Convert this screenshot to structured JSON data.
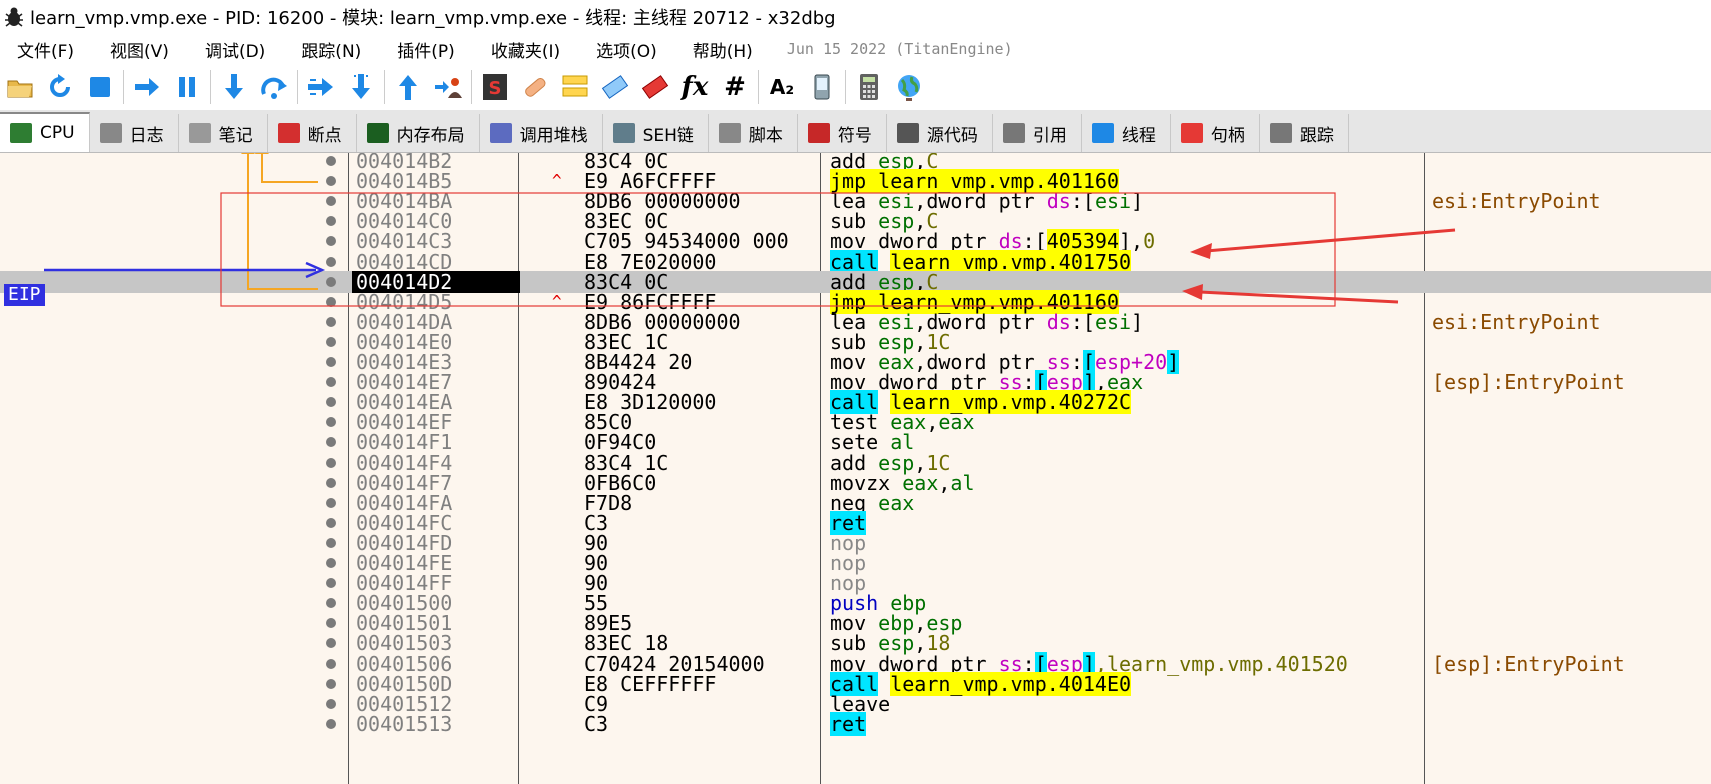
{
  "window": {
    "title": "learn_vmp.vmp.exe - PID: 16200 - 模块: learn_vmp.vmp.exe - 线程: 主线程 20712 - x32dbg"
  },
  "menu": {
    "items": [
      "文件(F)",
      "视图(V)",
      "调试(D)",
      "跟踪(N)",
      "插件(P)",
      "收藏夹(I)",
      "选项(O)",
      "帮助(H)"
    ],
    "build": "Jun 15 2022 (TitanEngine)"
  },
  "toolbar": {
    "icons": [
      "open-icon",
      "restart-icon",
      "stop-icon",
      "run-icon",
      "pause-icon",
      "step-into-icon",
      "step-over-icon",
      "trace-into-icon",
      "trace-over-icon",
      "execute-till-return-icon",
      "run-to-user-code-icon",
      "scylla-icon",
      "patch-icon",
      "comment-icon",
      "label-icon",
      "bookmark-icon",
      "function-icon",
      "hash-icon",
      "font-icon",
      "device-icon",
      "calculator-icon",
      "globe-icon"
    ],
    "fx_label": "fx",
    "hash_label": "#",
    "font_label": "A₂"
  },
  "tabs": [
    {
      "label": "CPU",
      "icon": "cpu-icon",
      "color": "#2e7d32"
    },
    {
      "label": "日志",
      "icon": "log-icon",
      "color": "#888888"
    },
    {
      "label": "笔记",
      "icon": "notes-icon",
      "color": "#999999"
    },
    {
      "label": "断点",
      "icon": "breakpoint-icon",
      "color": "#d32f2f"
    },
    {
      "label": "内存布局",
      "icon": "memory-icon",
      "color": "#1b5e20"
    },
    {
      "label": "调用堆栈",
      "icon": "callstack-icon",
      "color": "#5c6bc0"
    },
    {
      "label": "SEH链",
      "icon": "seh-icon",
      "color": "#607d8b"
    },
    {
      "label": "脚本",
      "icon": "script-icon",
      "color": "#888888"
    },
    {
      "label": "符号",
      "icon": "symbol-icon",
      "color": "#c62828"
    },
    {
      "label": "源代码",
      "icon": "source-icon",
      "color": "#555555"
    },
    {
      "label": "引用",
      "icon": "reference-icon",
      "color": "#777777"
    },
    {
      "label": "线程",
      "icon": "thread-icon",
      "color": "#1e88e5"
    },
    {
      "label": "句柄",
      "icon": "handle-icon",
      "color": "#e53935"
    },
    {
      "label": "跟踪",
      "icon": "trace-icon",
      "color": "#777777"
    }
  ],
  "eip_label": "EIP",
  "rows": [
    {
      "addr": "004014B2",
      "mark": "",
      "bytes": "83C4 0C",
      "dis": [
        [
          "add ",
          ""
        ],
        [
          "esp",
          "reg"
        ],
        [
          ",",
          ""
        ],
        [
          "C",
          "num"
        ]
      ],
      "comment": ""
    },
    {
      "addr": "004014B5",
      "mark": "^",
      "bytes": "E9 A6FCFFFF",
      "dis": [
        [
          "jmp learn_vmp.vmp.401160",
          "hl-y"
        ]
      ],
      "comment": ""
    },
    {
      "addr": "004014BA",
      "mark": "",
      "bytes": "8DB6 00000000",
      "dis": [
        [
          "lea ",
          ""
        ],
        [
          "esi",
          "reg"
        ],
        [
          ",dword ptr ",
          ""
        ],
        [
          "ds",
          "seg"
        ],
        [
          ":[",
          ""
        ],
        [
          "esi",
          "reg"
        ],
        [
          "]",
          ""
        ]
      ],
      "comment": "esi:EntryPoint"
    },
    {
      "addr": "004014C0",
      "mark": "",
      "bytes": "83EC 0C",
      "dis": [
        [
          "sub ",
          ""
        ],
        [
          "esp",
          "reg"
        ],
        [
          ",",
          ""
        ],
        [
          "C",
          "num"
        ]
      ],
      "comment": ""
    },
    {
      "addr": "004014C3",
      "mark": "",
      "bytes": "C705 94534000 000",
      "dis": [
        [
          "mov dword ptr ",
          ""
        ],
        [
          "ds",
          "seg"
        ],
        [
          ":[",
          ""
        ],
        [
          "405394",
          "hl-y"
        ],
        [
          "],",
          ""
        ],
        [
          "0",
          "num"
        ]
      ],
      "comment": ""
    },
    {
      "addr": "004014CD",
      "mark": "",
      "bytes": "E8 7E020000",
      "dis": [
        [
          "call",
          "hl-c"
        ],
        [
          " ",
          ""
        ],
        [
          "learn_vmp.vmp.401750",
          "hl-y"
        ]
      ],
      "comment": ""
    },
    {
      "addr": "004014D2",
      "mark": "",
      "bytes": "83C4 0C",
      "dis": [
        [
          "add ",
          ""
        ],
        [
          "esp",
          "reg"
        ],
        [
          ",",
          ""
        ],
        [
          "C",
          "num"
        ]
      ],
      "comment": "",
      "current": true
    },
    {
      "addr": "004014D5",
      "mark": "^",
      "bytes": "E9 86FCFFFF",
      "dis": [
        [
          "jmp learn_vmp.vmp.401160",
          "hl-y"
        ]
      ],
      "comment": ""
    },
    {
      "addr": "004014DA",
      "mark": "",
      "bytes": "8DB6 00000000",
      "dis": [
        [
          "lea ",
          ""
        ],
        [
          "esi",
          "reg"
        ],
        [
          ",dword ptr ",
          ""
        ],
        [
          "ds",
          "seg"
        ],
        [
          ":[",
          ""
        ],
        [
          "esi",
          "reg"
        ],
        [
          "]",
          ""
        ]
      ],
      "comment": "esi:EntryPoint"
    },
    {
      "addr": "004014E0",
      "mark": "",
      "bytes": "83EC 1C",
      "dis": [
        [
          "sub ",
          ""
        ],
        [
          "esp",
          "reg"
        ],
        [
          ",",
          ""
        ],
        [
          "1C",
          "num"
        ]
      ],
      "comment": ""
    },
    {
      "addr": "004014E3",
      "mark": "",
      "bytes": "8B4424 20",
      "dis": [
        [
          "mov ",
          ""
        ],
        [
          "eax",
          "reg"
        ],
        [
          ",dword ptr ",
          ""
        ],
        [
          "ss",
          "seg"
        ],
        [
          ":",
          ""
        ],
        [
          "[",
          "hl-c"
        ],
        [
          "esp+20",
          "seg"
        ],
        [
          "]",
          "hl-c"
        ]
      ],
      "comment": ""
    },
    {
      "addr": "004014E7",
      "mark": "",
      "bytes": "890424",
      "dis": [
        [
          "mov dword ptr ",
          ""
        ],
        [
          "ss",
          "seg"
        ],
        [
          ":",
          ""
        ],
        [
          "[",
          "hl-c"
        ],
        [
          "esp",
          "seg"
        ],
        [
          "]",
          "hl-c"
        ],
        [
          ",",
          ""
        ],
        [
          "eax",
          "reg"
        ]
      ],
      "comment": "[esp]:EntryPoint"
    },
    {
      "addr": "004014EA",
      "mark": "",
      "bytes": "E8 3D120000",
      "dis": [
        [
          "call",
          "hl-c"
        ],
        [
          " ",
          ""
        ],
        [
          "learn_vmp.vmp.40272C",
          "hl-y"
        ]
      ],
      "comment": ""
    },
    {
      "addr": "004014EF",
      "mark": "",
      "bytes": "85C0",
      "dis": [
        [
          "test ",
          ""
        ],
        [
          "eax",
          "reg"
        ],
        [
          ",",
          ""
        ],
        [
          "eax",
          "reg"
        ]
      ],
      "comment": ""
    },
    {
      "addr": "004014F1",
      "mark": "",
      "bytes": "0F94C0",
      "dis": [
        [
          "sete ",
          ""
        ],
        [
          "al",
          "reg"
        ]
      ],
      "comment": ""
    },
    {
      "addr": "004014F4",
      "mark": "",
      "bytes": "83C4 1C",
      "dis": [
        [
          "add ",
          ""
        ],
        [
          "esp",
          "reg"
        ],
        [
          ",",
          ""
        ],
        [
          "1C",
          "num"
        ]
      ],
      "comment": ""
    },
    {
      "addr": "004014F7",
      "mark": "",
      "bytes": "0FB6C0",
      "dis": [
        [
          "movzx ",
          ""
        ],
        [
          "eax",
          "reg"
        ],
        [
          ",",
          ""
        ],
        [
          "al",
          "reg"
        ]
      ],
      "comment": ""
    },
    {
      "addr": "004014FA",
      "mark": "",
      "bytes": "F7D8",
      "dis": [
        [
          "neg ",
          ""
        ],
        [
          "eax",
          "reg"
        ]
      ],
      "comment": ""
    },
    {
      "addr": "004014FC",
      "mark": "",
      "bytes": "C3",
      "dis": [
        [
          "ret",
          "hl-c"
        ]
      ],
      "comment": ""
    },
    {
      "addr": "004014FD",
      "mark": "",
      "bytes": "90",
      "dis": [
        [
          "nop",
          "nop"
        ]
      ],
      "comment": ""
    },
    {
      "addr": "004014FE",
      "mark": "",
      "bytes": "90",
      "dis": [
        [
          "nop",
          "nop"
        ]
      ],
      "comment": ""
    },
    {
      "addr": "004014FF",
      "mark": "",
      "bytes": "90",
      "dis": [
        [
          "nop",
          "nop"
        ]
      ],
      "comment": ""
    },
    {
      "addr": "00401500",
      "mark": "",
      "bytes": "55",
      "dis": [
        [
          "push ",
          "kw-blue"
        ],
        [
          "ebp",
          "reg"
        ]
      ],
      "comment": ""
    },
    {
      "addr": "00401501",
      "mark": "",
      "bytes": "89E5",
      "dis": [
        [
          "mov ",
          ""
        ],
        [
          "ebp",
          "reg"
        ],
        [
          ",",
          ""
        ],
        [
          "esp",
          "reg"
        ]
      ],
      "comment": ""
    },
    {
      "addr": "00401503",
      "mark": "",
      "bytes": "83EC 18",
      "dis": [
        [
          "sub ",
          ""
        ],
        [
          "esp",
          "reg"
        ],
        [
          ",",
          ""
        ],
        [
          "18",
          "num"
        ]
      ],
      "comment": ""
    },
    {
      "addr": "00401506",
      "mark": "",
      "bytes": "C70424 20154000",
      "dis": [
        [
          "mov dword ptr ",
          ""
        ],
        [
          "ss",
          "seg"
        ],
        [
          ":",
          ""
        ],
        [
          "[",
          "hl-c"
        ],
        [
          "esp",
          "seg"
        ],
        [
          "]",
          "hl-c"
        ],
        [
          ",learn_vmp.vmp.401520",
          "num"
        ]
      ],
      "comment": "[esp]:EntryPoint"
    },
    {
      "addr": "0040150D",
      "mark": "",
      "bytes": "E8 CEFFFFFF",
      "dis": [
        [
          "call",
          "hl-c"
        ],
        [
          " ",
          ""
        ],
        [
          "learn_vmp.vmp.4014E0",
          "hl-y"
        ]
      ],
      "comment": ""
    },
    {
      "addr": "00401512",
      "mark": "",
      "bytes": "C9",
      "dis": [
        [
          "leave",
          ""
        ]
      ],
      "comment": ""
    },
    {
      "addr": "00401513",
      "mark": "",
      "bytes": "C3",
      "dis": [
        [
          "ret",
          "hl-c"
        ]
      ],
      "comment": ""
    }
  ]
}
